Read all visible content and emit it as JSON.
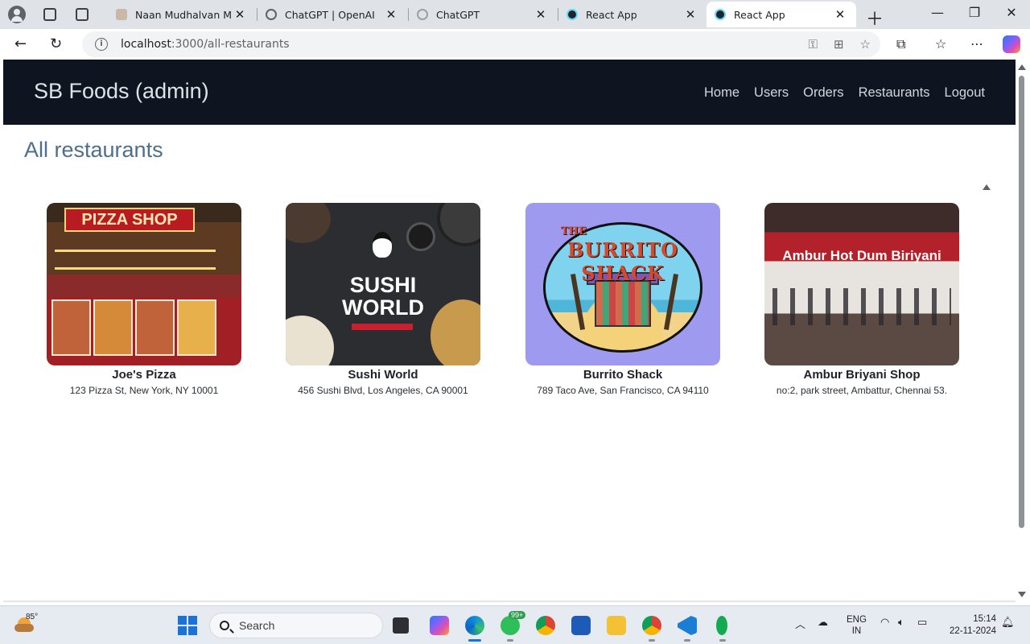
{
  "browser": {
    "tabs": [
      {
        "title": "Naan Mudhalvan Massi",
        "favicon": "site-icon",
        "active": false
      },
      {
        "title": "ChatGPT | OpenAI",
        "favicon": "openai-icon",
        "active": false
      },
      {
        "title": "ChatGPT",
        "favicon": "openai-icon",
        "active": false
      },
      {
        "title": "React App",
        "favicon": "react-icon",
        "active": false
      },
      {
        "title": "React App",
        "favicon": "react-icon",
        "active": true
      }
    ],
    "url_host": "localhost",
    "url_path": ":3000/all-restaurants"
  },
  "app": {
    "brand": "SB Foods (admin)",
    "nav": [
      "Home",
      "Users",
      "Orders",
      "Restaurants",
      "Logout"
    ],
    "page_title": "All restaurants",
    "restaurants": [
      {
        "name": "Joe's Pizza",
        "address": "123 Pizza St, New York, NY 10001",
        "image_text": "PIZZA SHOP"
      },
      {
        "name": "Sushi World",
        "address": "456 Sushi Blvd, Los Angeles, CA 90001",
        "image_text": "SUSHI WORLD"
      },
      {
        "name": "Burrito Shack",
        "address": "789 Taco Ave, San Francisco, CA 94110",
        "image_text": "BURRITO SHACK",
        "image_subtext": "THE"
      },
      {
        "name": "Ambur Briyani Shop",
        "address": "no:2, park street, Ambattur, Chennai 53.",
        "image_text": "Ambur Hot Dum Biriyani"
      }
    ]
  },
  "taskbar": {
    "weather_temp": "85°",
    "search_placeholder": "Search",
    "whatsapp_badge": "99+",
    "lang_line1": "ENG",
    "lang_line2": "IN",
    "time": "15:14",
    "date": "22-11-2024"
  },
  "colors": {
    "header_bg": "#0e1521",
    "title_color": "#4d6f8c",
    "accent_blue": "#1a73d9"
  }
}
